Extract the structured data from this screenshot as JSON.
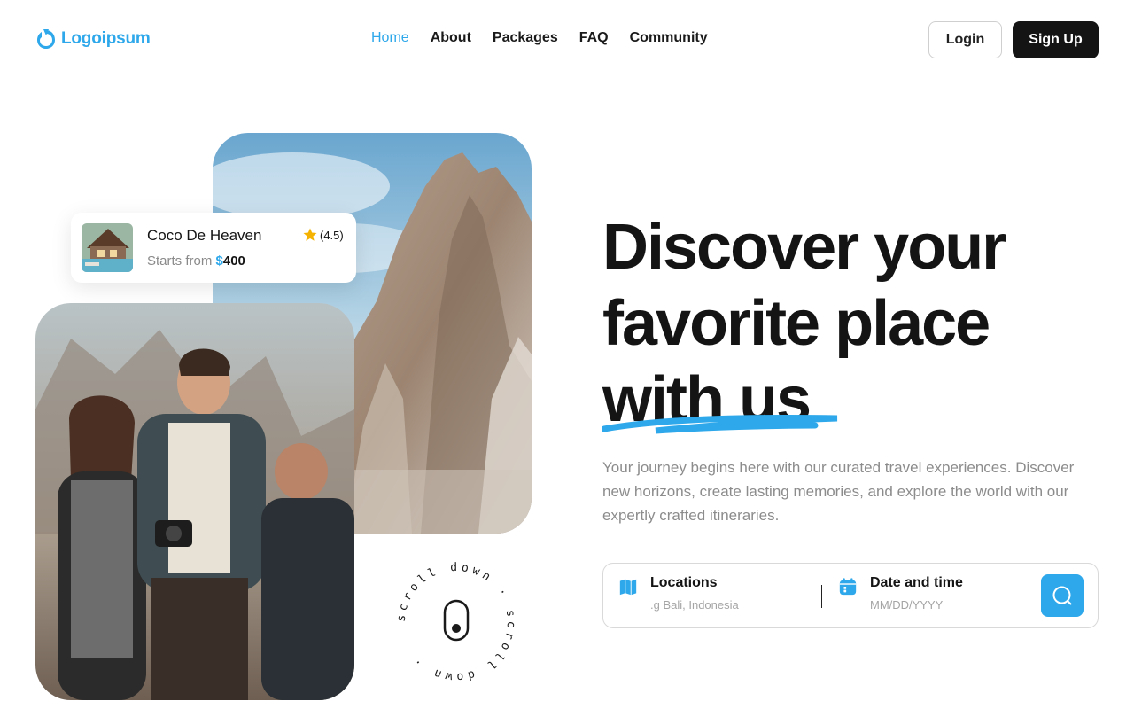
{
  "brand": {
    "name": "Logoipsum",
    "color": "#2ea8ea"
  },
  "nav": {
    "items": [
      {
        "label": "Home",
        "active": true
      },
      {
        "label": "About",
        "active": false
      },
      {
        "label": "Packages",
        "active": false
      },
      {
        "label": "FAQ",
        "active": false
      },
      {
        "label": "Community",
        "active": false
      }
    ]
  },
  "auth": {
    "login_label": "Login",
    "signup_label": "Sign Up"
  },
  "property_card": {
    "name": "Coco De Heaven",
    "rating": "(4.5)",
    "price_prefix": "Starts from",
    "currency": "$",
    "price": "400",
    "rating_icon": "star-icon"
  },
  "scroll_badge": {
    "text": "scroll down · scroll down · "
  },
  "hero": {
    "title_line1": "Discover your",
    "title_line2": "favorite place",
    "title_line3": "with us",
    "description": "Your journey begins here with our curated travel experiences. Discover new horizons, create lasting memories, and explore the world with our expertly crafted itineraries."
  },
  "search": {
    "location_label": "Locations",
    "location_placeholder": ".g Bali, Indonesia",
    "date_label": "Date and time",
    "date_placeholder": "MM/DD/YYYY",
    "location_icon": "map-icon",
    "date_icon": "calendar-icon",
    "button_icon": "search-icon"
  },
  "colors": {
    "accent": "#2ea8ea",
    "dark": "#141414",
    "muted": "#8c8c8c"
  }
}
